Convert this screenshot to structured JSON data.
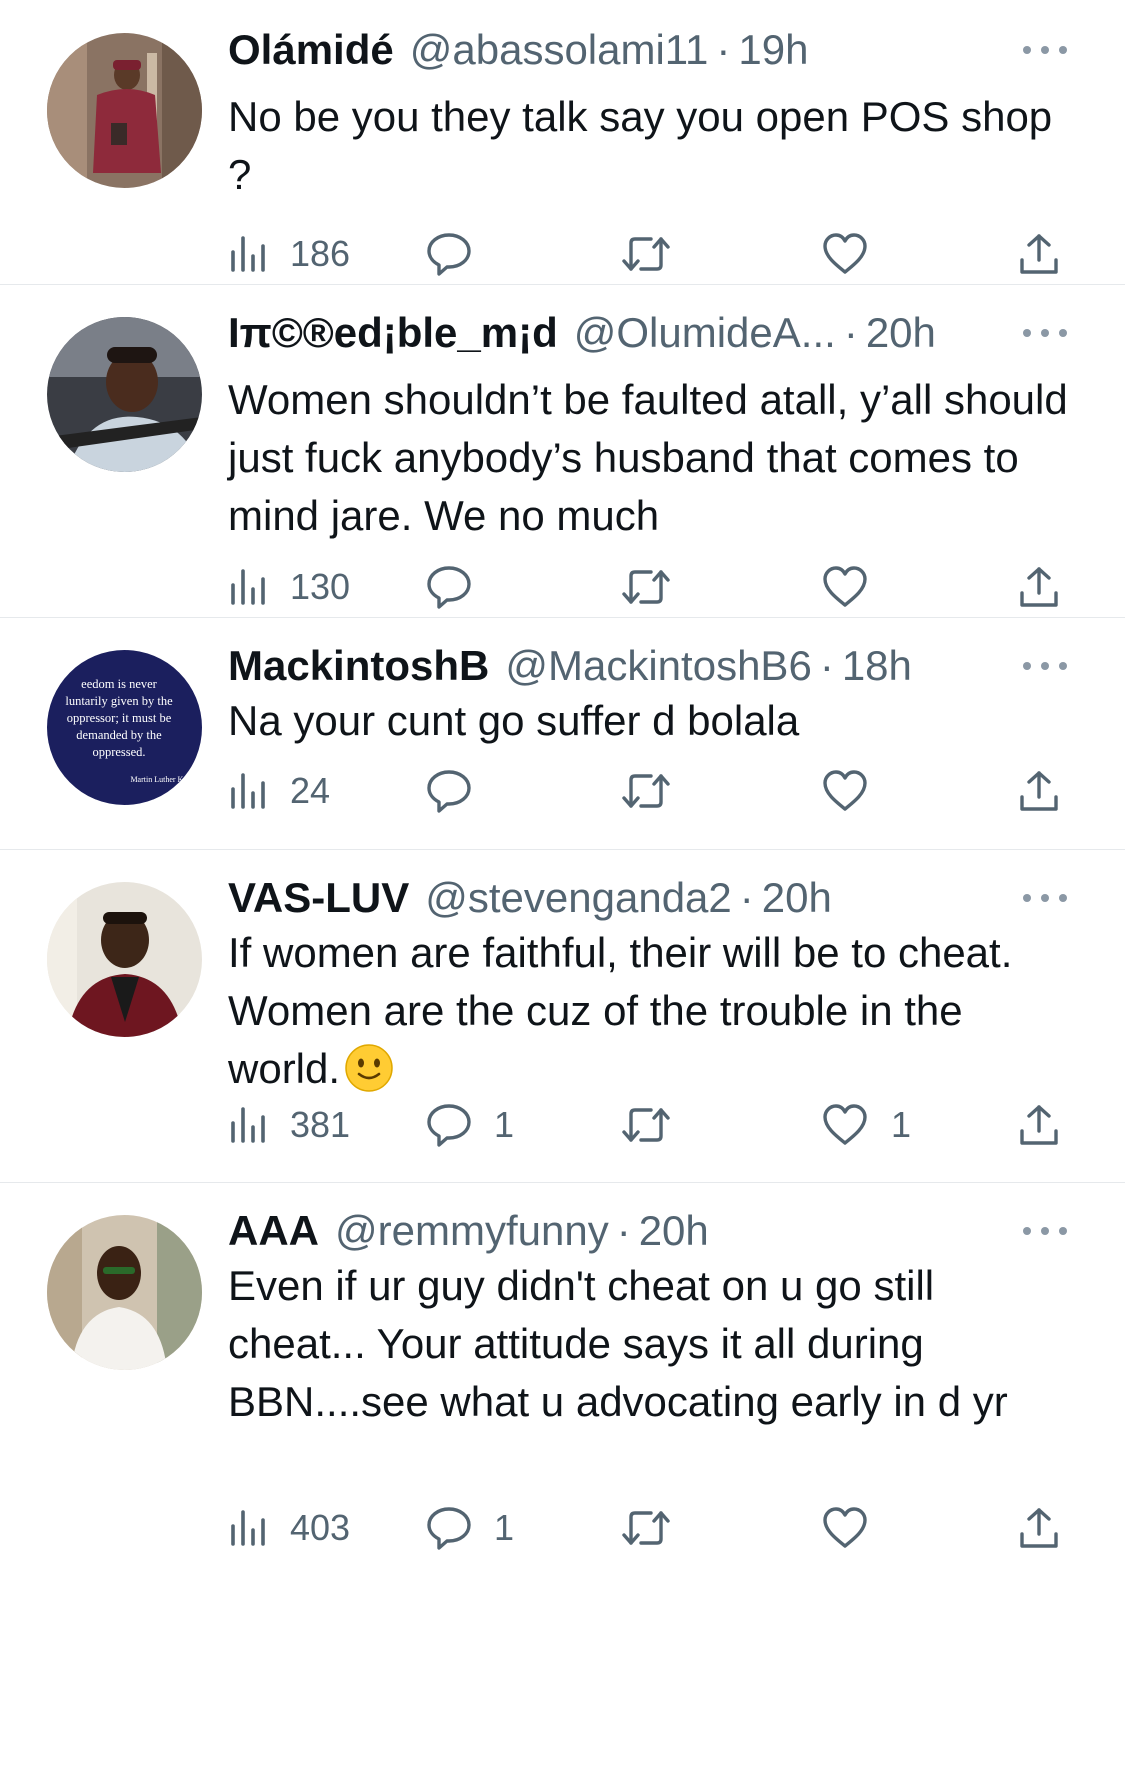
{
  "tweets": [
    {
      "name": "Olámidé",
      "handle": "@abassolami11",
      "separator": "·",
      "time": "19h",
      "text": "No be you they talk say you open POS shop ?",
      "views": "186",
      "replies": "",
      "retweets": "",
      "likes": "",
      "avatar": "person-in-red-agbada"
    },
    {
      "name": "Iπ©®ed¡ble_m¡d",
      "handle": "@OlumideA...",
      "separator": "·",
      "time": "20h",
      "text": "Women shouldn’t be faulted atall, y’all should just fuck anybody’s husband that comes to mind jare. We no much",
      "views": "130",
      "replies": "",
      "retweets": "",
      "likes": "",
      "avatar": "man-in-car"
    },
    {
      "name": "MackintoshB",
      "handle": "@MackintoshB6",
      "separator": "·",
      "time": "18h",
      "text": "Na your cunt go suffer d bolala",
      "views": "24",
      "replies": "",
      "retweets": "",
      "likes": "",
      "avatar": "quote-image",
      "avatar_quote": [
        "eedom is never",
        "luntarily given by the",
        "oppressor; it must be",
        "demanded by the",
        "oppressed."
      ],
      "avatar_attribution": "Martin Luther King"
    },
    {
      "name": "VAS-LUV",
      "handle": "@stevenganda2",
      "separator": "·",
      "time": "20h",
      "text": "If women are faithful, their will be to cheat. Women are the cuz of the trouble in the world.",
      "emoji": "slightly-smiling-face",
      "views": "381",
      "replies": "1",
      "retweets": "",
      "likes": "1",
      "avatar": "man-in-maroon-blazer"
    },
    {
      "name": "AAA",
      "handle": "@remmyfunny",
      "separator": "·",
      "time": "20h",
      "text": "Even if ur guy didn't cheat on u go still cheat... Your attitude says it all during BBN....see what u advocating early in d yr",
      "views": "403",
      "replies": "1",
      "retweets": "",
      "likes": "",
      "avatar": "man-in-white"
    }
  ],
  "icons": {
    "views": "views-bar-chart-icon",
    "reply": "reply-bubble-icon",
    "retweet": "retweet-icon",
    "like": "heart-icon",
    "share": "share-upload-icon",
    "more": "more-options-icon"
  },
  "colors": {
    "text": "#0f1419",
    "secondary": "#536471",
    "divider": "#e6e9ec"
  }
}
